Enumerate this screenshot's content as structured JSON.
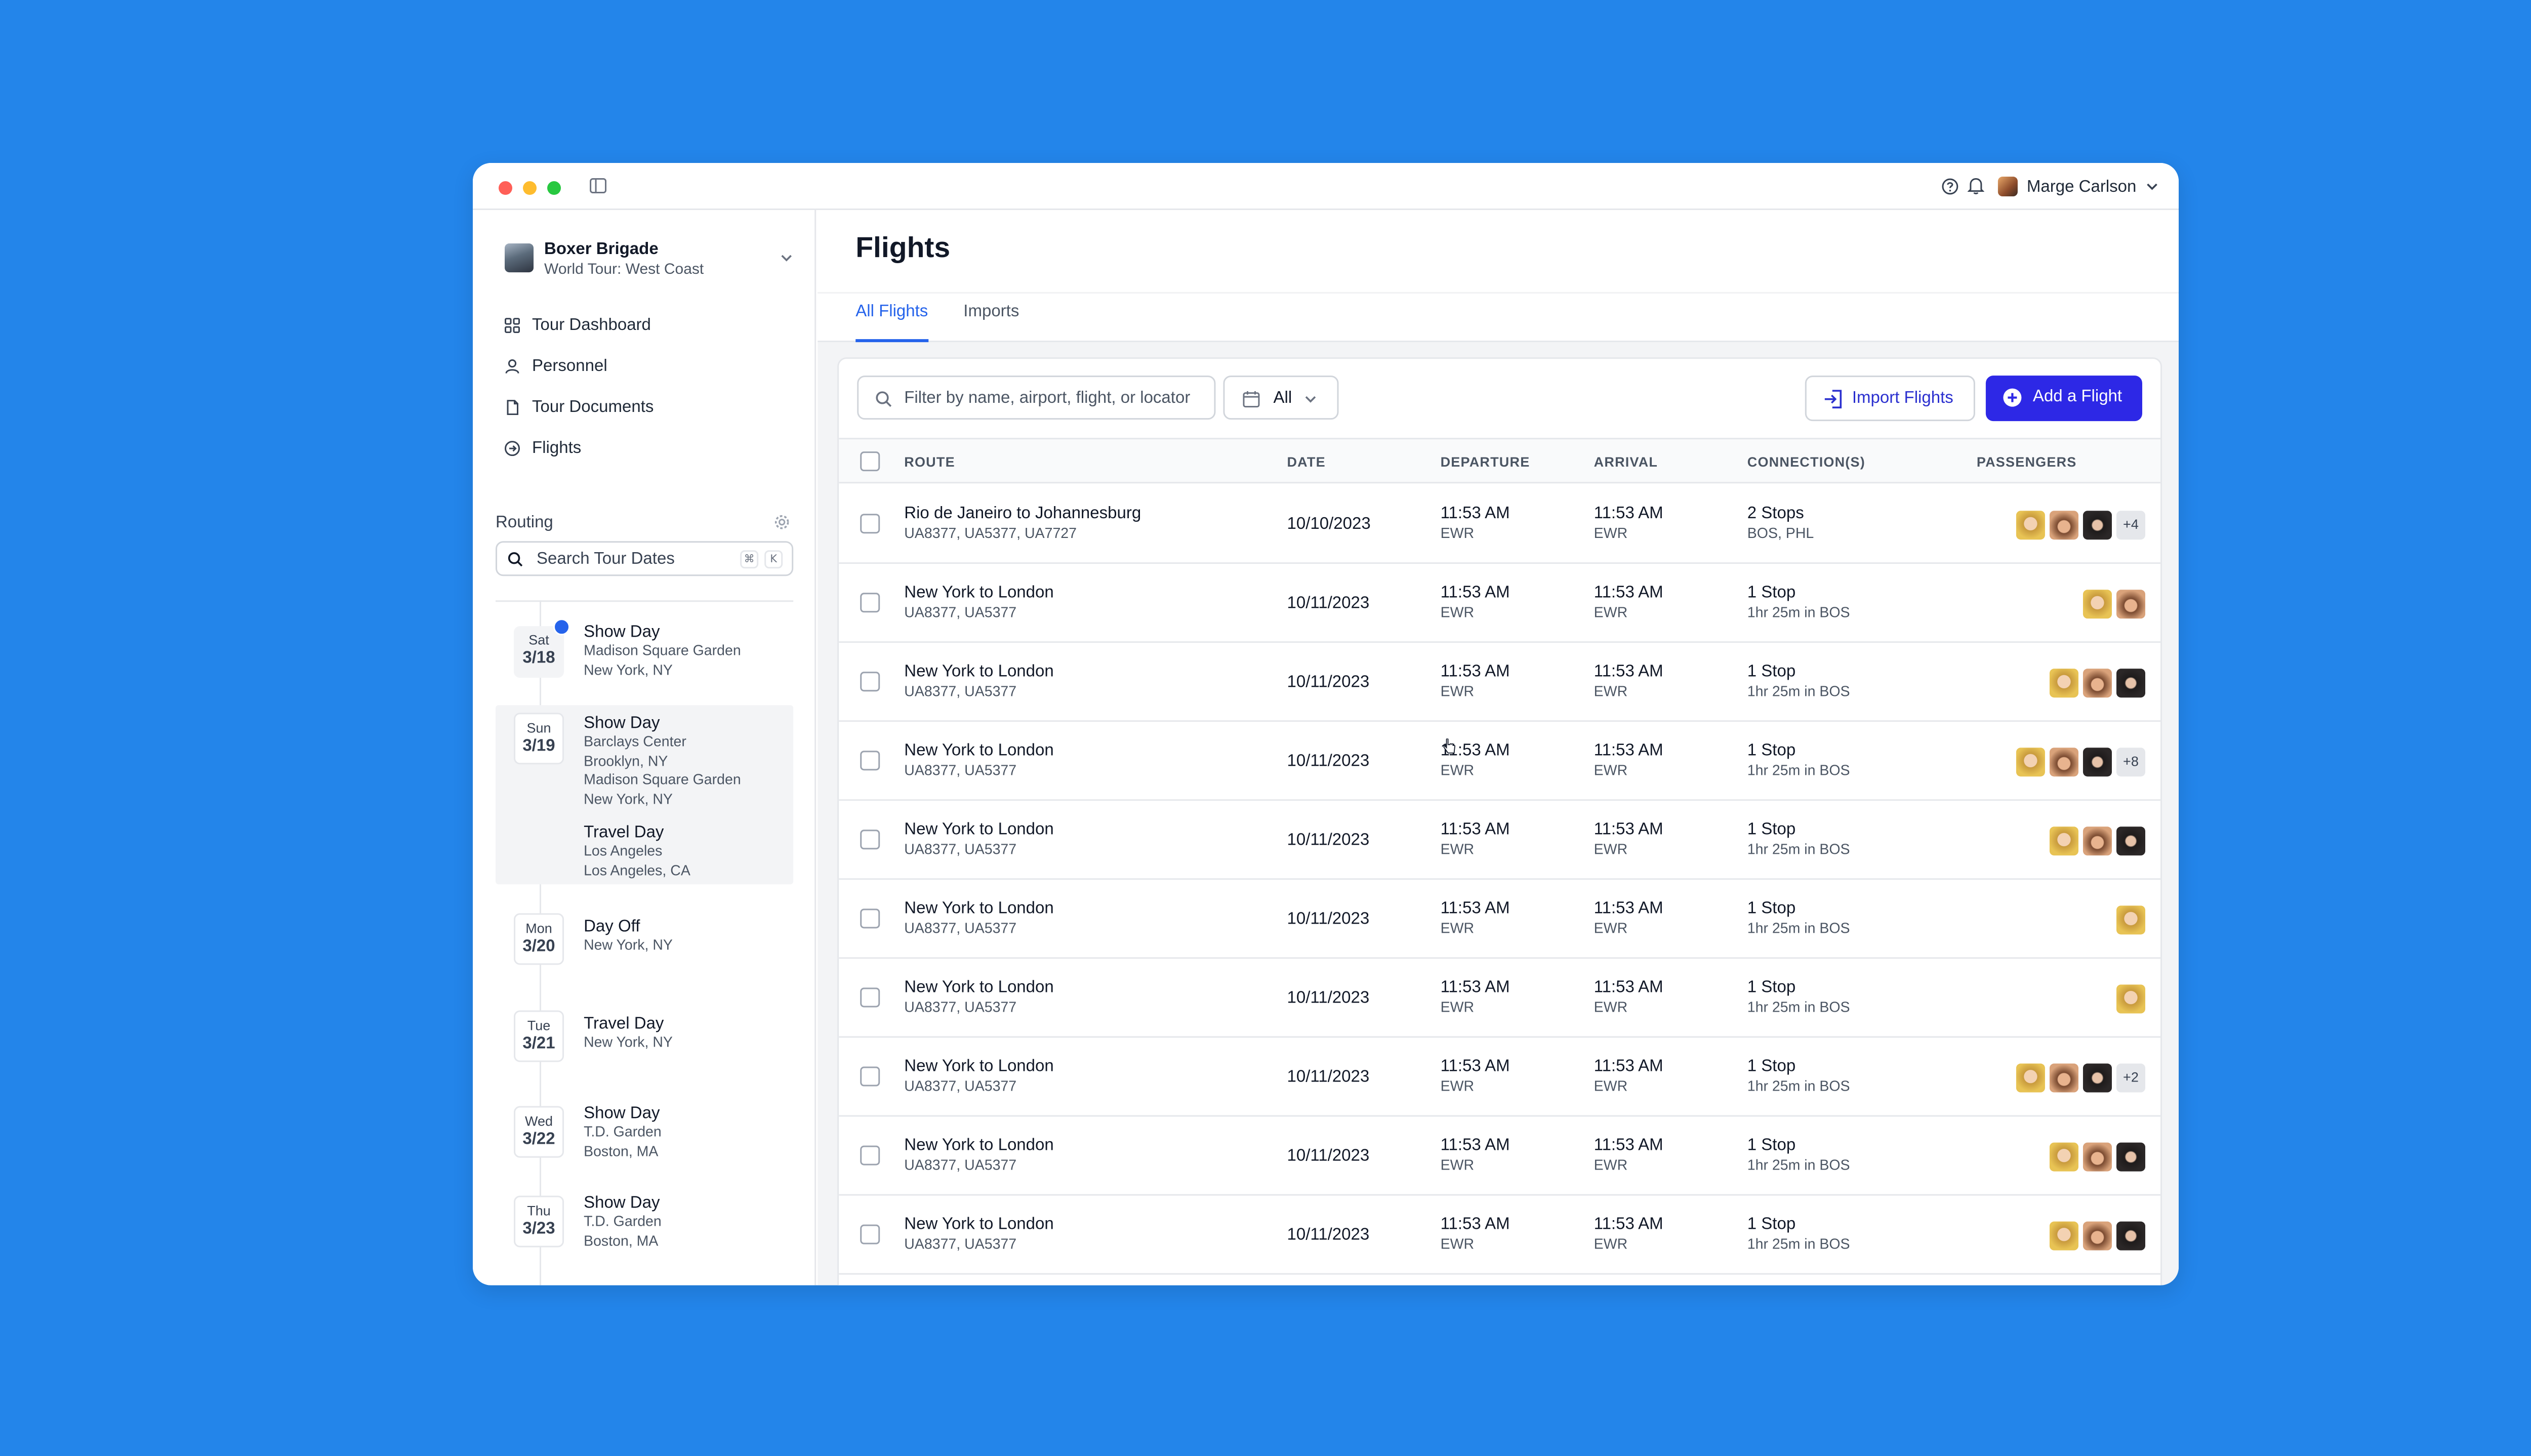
{
  "user": {
    "name": "Marge Carlson"
  },
  "org": {
    "name": "Boxer Brigade",
    "subtitle": "World Tour: West Coast"
  },
  "nav": [
    {
      "label": "Tour Dashboard",
      "icon": "grid-icon"
    },
    {
      "label": "Personnel",
      "icon": "user-icon"
    },
    {
      "label": "Tour Documents",
      "icon": "document-icon"
    },
    {
      "label": "Flights",
      "icon": "plane-icon"
    }
  ],
  "routing": {
    "title": "Routing",
    "search_label": "Search Tour Dates",
    "shortcut": [
      "⌘",
      "K"
    ],
    "days": [
      {
        "dow": "Sat",
        "date": "3/18",
        "events": [
          {
            "title": "Show Day",
            "lines": [
              "Madison Square Garden",
              "New York, NY"
            ]
          }
        ]
      },
      {
        "dow": "Sun",
        "date": "3/19",
        "events": [
          {
            "title": "Show Day",
            "lines": [
              "Barclays Center",
              "Brooklyn, NY",
              "Madison Square Garden",
              "New York, NY"
            ]
          },
          {
            "title": "Travel Day",
            "lines": [
              "Los Angeles",
              "Los Angeles, CA"
            ]
          }
        ]
      },
      {
        "dow": "Mon",
        "date": "3/20",
        "events": [
          {
            "title": "Day Off",
            "lines": [
              "New York, NY"
            ]
          }
        ]
      },
      {
        "dow": "Tue",
        "date": "3/21",
        "events": [
          {
            "title": "Travel Day",
            "lines": [
              "New York, NY"
            ]
          }
        ]
      },
      {
        "dow": "Wed",
        "date": "3/22",
        "events": [
          {
            "title": "Show Day",
            "lines": [
              "T.D. Garden",
              "Boston, MA"
            ]
          }
        ]
      },
      {
        "dow": "Thu",
        "date": "3/23",
        "events": [
          {
            "title": "Show Day",
            "lines": [
              "T.D. Garden",
              "Boston, MA"
            ]
          }
        ]
      }
    ]
  },
  "page": {
    "title": "Flights",
    "tabs": [
      "All Flights",
      "Imports"
    ],
    "active_tab": "All Flights"
  },
  "toolbar": {
    "filter_placeholder": "Filter by name, airport, flight, or locator",
    "date_filter": "All",
    "import_label": "Import Flights",
    "add_label": "Add a Flight"
  },
  "table": {
    "columns": [
      "ROUTE",
      "DATE",
      "DEPARTURE",
      "ARRIVAL",
      "CONNECTION(S)",
      "PASSENGERS"
    ],
    "rows": [
      {
        "route": "Rio de Janeiro to Johannesburg",
        "flights": "UA8377, UA5377, UA7727",
        "date": "10/10/2023",
        "dep_time": "11:53 AM",
        "dep_airport": "EWR",
        "arr_time": "11:53 AM",
        "arr_airport": "EWR",
        "conn": "2 Stops",
        "conn_detail": "BOS, PHL",
        "avatars": 3,
        "more": "+4"
      },
      {
        "route": "New York to London",
        "flights": "UA8377, UA5377",
        "date": "10/11/2023",
        "dep_time": "11:53 AM",
        "dep_airport": "EWR",
        "arr_time": "11:53 AM",
        "arr_airport": "EWR",
        "conn": "1 Stop",
        "conn_detail": "1hr 25m in BOS",
        "avatars": 2,
        "more": ""
      },
      {
        "route": "New York to London",
        "flights": "UA8377, UA5377",
        "date": "10/11/2023",
        "dep_time": "11:53 AM",
        "dep_airport": "EWR",
        "arr_time": "11:53 AM",
        "arr_airport": "EWR",
        "conn": "1 Stop",
        "conn_detail": "1hr 25m in BOS",
        "avatars": 3,
        "more": ""
      },
      {
        "route": "New York to London",
        "flights": "UA8377, UA5377",
        "date": "10/11/2023",
        "dep_time": "11:53 AM",
        "dep_airport": "EWR",
        "arr_time": "11:53 AM",
        "arr_airport": "EWR",
        "conn": "1 Stop",
        "conn_detail": "1hr 25m in BOS",
        "avatars": 3,
        "more": "+8"
      },
      {
        "route": "New York to London",
        "flights": "UA8377, UA5377",
        "date": "10/11/2023",
        "dep_time": "11:53 AM",
        "dep_airport": "EWR",
        "arr_time": "11:53 AM",
        "arr_airport": "EWR",
        "conn": "1 Stop",
        "conn_detail": "1hr 25m in BOS",
        "avatars": 3,
        "more": ""
      },
      {
        "route": "New York to London",
        "flights": "UA8377, UA5377",
        "date": "10/11/2023",
        "dep_time": "11:53 AM",
        "dep_airport": "EWR",
        "arr_time": "11:53 AM",
        "arr_airport": "EWR",
        "conn": "1 Stop",
        "conn_detail": "1hr 25m in BOS",
        "avatars": 1,
        "more": ""
      },
      {
        "route": "New York to London",
        "flights": "UA8377, UA5377",
        "date": "10/11/2023",
        "dep_time": "11:53 AM",
        "dep_airport": "EWR",
        "arr_time": "11:53 AM",
        "arr_airport": "EWR",
        "conn": "1 Stop",
        "conn_detail": "1hr 25m in BOS",
        "avatars": 1,
        "more": ""
      },
      {
        "route": "New York to London",
        "flights": "UA8377, UA5377",
        "date": "10/11/2023",
        "dep_time": "11:53 AM",
        "dep_airport": "EWR",
        "arr_time": "11:53 AM",
        "arr_airport": "EWR",
        "conn": "1 Stop",
        "conn_detail": "1hr 25m in BOS",
        "avatars": 3,
        "more": "+2"
      },
      {
        "route": "New York to London",
        "flights": "UA8377, UA5377",
        "date": "10/11/2023",
        "dep_time": "11:53 AM",
        "dep_airport": "EWR",
        "arr_time": "11:53 AM",
        "arr_airport": "EWR",
        "conn": "1 Stop",
        "conn_detail": "1hr 25m in BOS",
        "avatars": 3,
        "more": ""
      },
      {
        "route": "New York to London",
        "flights": "UA8377, UA5377",
        "date": "10/11/2023",
        "dep_time": "11:53 AM",
        "dep_airport": "EWR",
        "arr_time": "11:53 AM",
        "arr_airport": "EWR",
        "conn": "1 Stop",
        "conn_detail": "1hr 25m in BOS",
        "avatars": 3,
        "more": ""
      }
    ]
  },
  "colors": {
    "background": "#2385EA",
    "accent": "#2563EB",
    "primary_button": "#2D28E6"
  }
}
